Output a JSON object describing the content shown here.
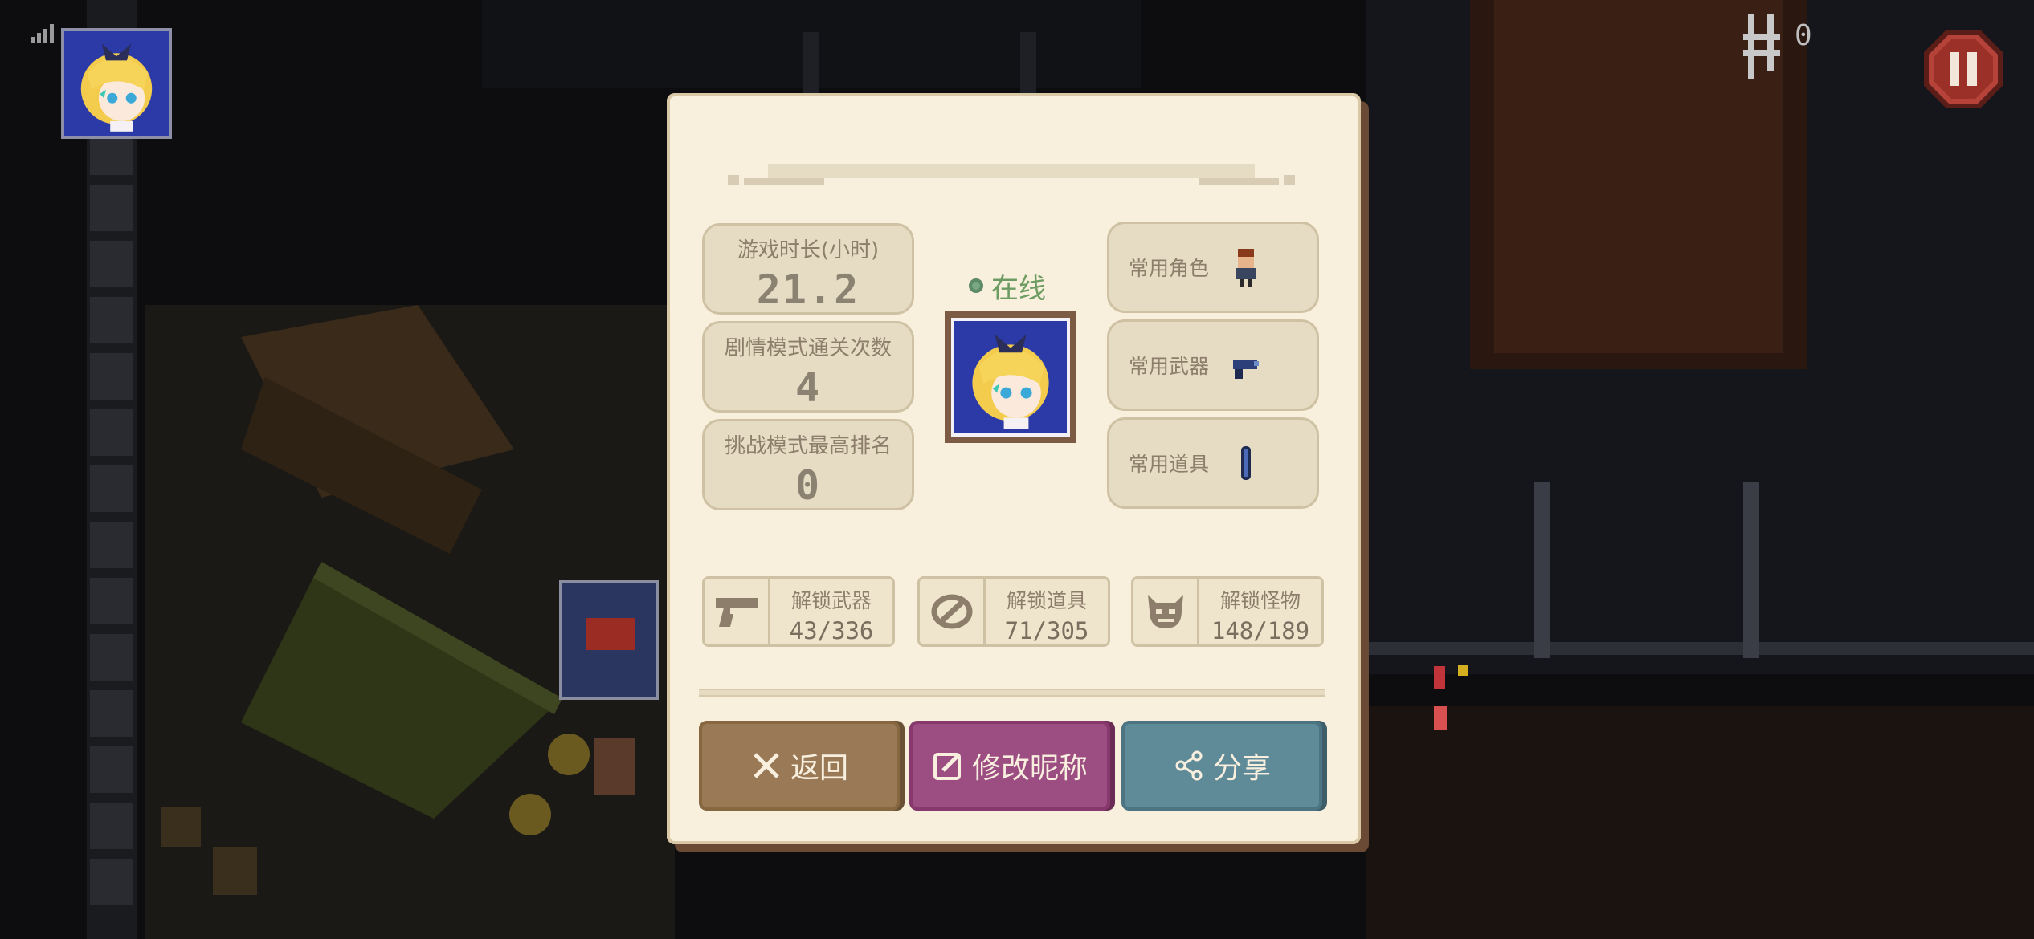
{
  "hud": {
    "floor_count": "0"
  },
  "dialog": {
    "title": "",
    "stats": [
      {
        "label": "游戏时长(小时)",
        "value": "21.2"
      },
      {
        "label": "剧情模式通关次数",
        "value": "4"
      },
      {
        "label": "挑战模式最高排名",
        "value": "0"
      }
    ],
    "status": "在线",
    "favorites": [
      {
        "label": "常用角色",
        "icon": "character-icon"
      },
      {
        "label": "常用武器",
        "icon": "weapon-icon"
      },
      {
        "label": "常用道具",
        "icon": "item-icon"
      }
    ],
    "unlocks": [
      {
        "label": "解锁武器",
        "value": "43/336",
        "icon": "pistol-icon"
      },
      {
        "label": "解锁道具",
        "value": "71/305",
        "icon": "item-icon"
      },
      {
        "label": "解锁怪物",
        "value": "148/189",
        "icon": "monster-icon"
      }
    ],
    "buttons": {
      "back": "返回",
      "rename": "修改昵称",
      "share": "分享"
    }
  },
  "colors": {
    "dialog_bg": "#f8f0dc",
    "back_button": "#9a7a56",
    "rename_button": "#9c4e82",
    "share_button": "#5f8a98",
    "online_green": "#6d9c62"
  }
}
